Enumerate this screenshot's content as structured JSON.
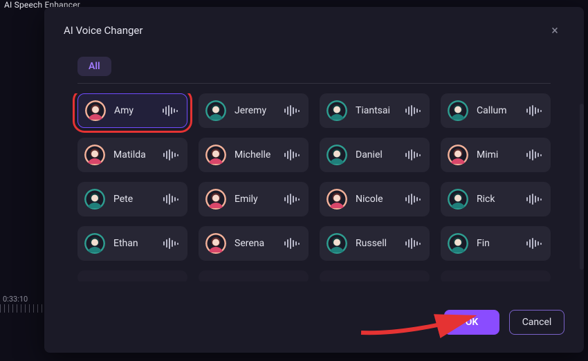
{
  "background": {
    "app_label": "AI Speech Enhancer",
    "timeline_code": "0:33:10"
  },
  "modal": {
    "title": "AI Voice Changer",
    "close_label": "×"
  },
  "tabs": {
    "all": "All"
  },
  "avatar_colors": {
    "peach": "#f4b29a",
    "teal": "#2e9e91"
  },
  "voices": [
    {
      "name": "Amy",
      "avatar": "peach",
      "selected": true,
      "highlighted": true
    },
    {
      "name": "Jeremy",
      "avatar": "teal",
      "selected": false,
      "highlighted": false
    },
    {
      "name": "Tiantsai",
      "avatar": "teal",
      "selected": false,
      "highlighted": false
    },
    {
      "name": "Callum",
      "avatar": "teal",
      "selected": false,
      "highlighted": false
    },
    {
      "name": "Matilda",
      "avatar": "peach",
      "selected": false,
      "highlighted": false
    },
    {
      "name": "Michelle",
      "avatar": "peach",
      "selected": false,
      "highlighted": false
    },
    {
      "name": "Daniel",
      "avatar": "teal",
      "selected": false,
      "highlighted": false
    },
    {
      "name": "Mimi",
      "avatar": "peach",
      "selected": false,
      "highlighted": false
    },
    {
      "name": "Pete",
      "avatar": "teal",
      "selected": false,
      "highlighted": false
    },
    {
      "name": "Emily",
      "avatar": "peach",
      "selected": false,
      "highlighted": false
    },
    {
      "name": "Nicole",
      "avatar": "peach",
      "selected": false,
      "highlighted": false
    },
    {
      "name": "Rick",
      "avatar": "teal",
      "selected": false,
      "highlighted": false
    },
    {
      "name": "Ethan",
      "avatar": "teal",
      "selected": false,
      "highlighted": false
    },
    {
      "name": "Serena",
      "avatar": "peach",
      "selected": false,
      "highlighted": false
    },
    {
      "name": "Russell",
      "avatar": "teal",
      "selected": false,
      "highlighted": false
    },
    {
      "name": "Fin",
      "avatar": "teal",
      "selected": false,
      "highlighted": false
    }
  ],
  "footer": {
    "ok": "OK",
    "cancel": "Cancel"
  }
}
